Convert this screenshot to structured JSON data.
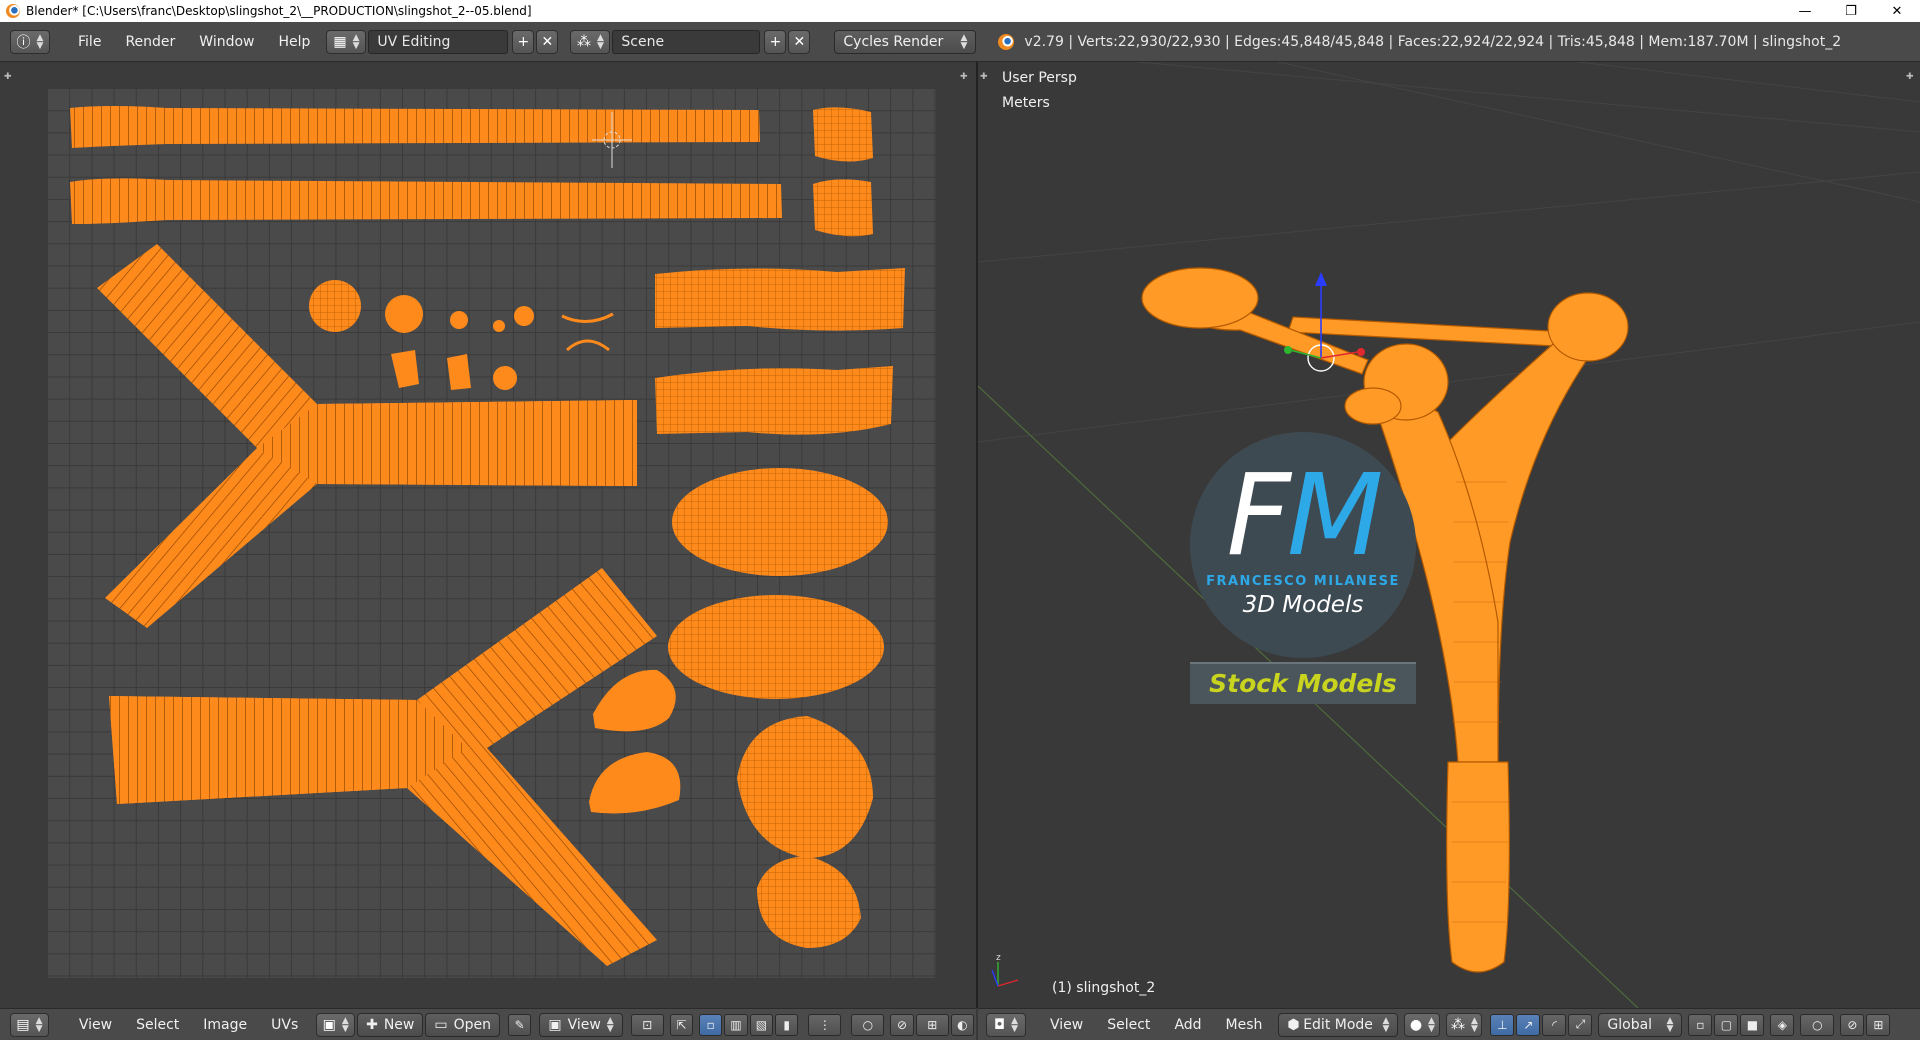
{
  "window": {
    "title": "Blender* [C:\\Users\\franc\\Desktop\\slingshot_2\\__PRODUCTION\\slingshot_2--05.blend]",
    "controls": [
      "—",
      "❐",
      "✕"
    ]
  },
  "info_header": {
    "menus": [
      "File",
      "Render",
      "Window",
      "Help"
    ],
    "layout": "UV Editing",
    "scene": "Scene",
    "render_engine": "Cycles Render",
    "stats": "v2.79 | Verts:22,930/22,930 | Edges:45,848/45,848 | Faces:22,924/22,924 | Tris:45,848 | Mem:187.70M | slingshot_2"
  },
  "uv_footer": {
    "menus": [
      "View",
      "Select",
      "Image",
      "UVs"
    ],
    "new_label": "New",
    "open_label": "Open",
    "view_label": "View"
  },
  "viewport": {
    "view_name": "User Persp",
    "units": "Meters",
    "object_label": "(1) slingshot_2"
  },
  "viewport_footer": {
    "menus": [
      "View",
      "Select",
      "Add",
      "Mesh"
    ],
    "mode": "Edit Mode",
    "orientation": "Global"
  },
  "logo": {
    "letters_f": "F",
    "letters_m": "M",
    "name": "FRANCESCO MILANESE",
    "sub": "3D Models",
    "stock": "Stock Models"
  },
  "colors": {
    "mesh_orange": "#ff8a1c",
    "mesh_wire": "#b35a00",
    "logo_blue": "#2ea9e8",
    "stock_yellow": "#c8d41e"
  }
}
